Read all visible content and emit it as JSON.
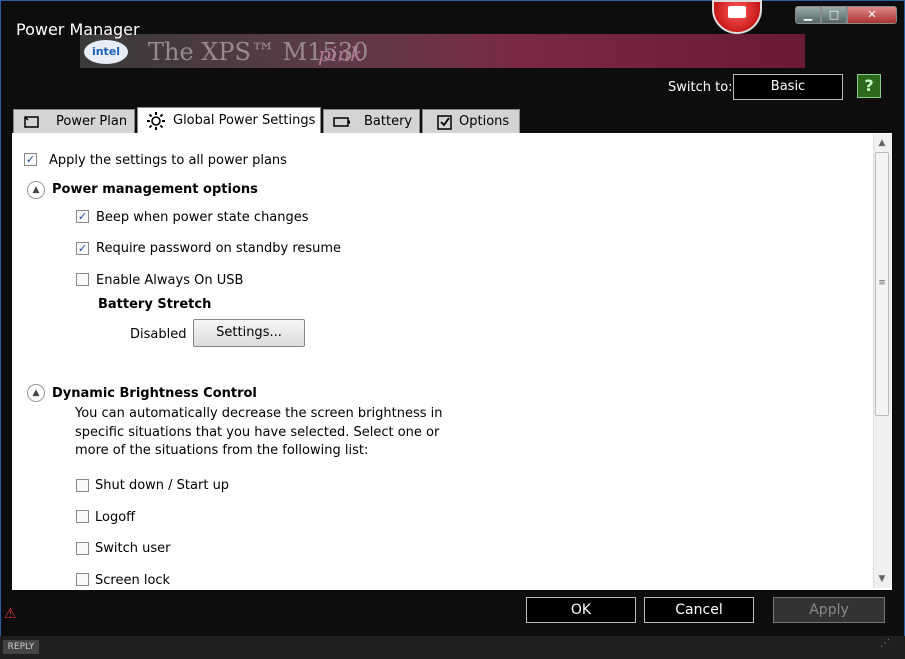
{
  "window": {
    "title": "Power Manager",
    "caption_min": "▁",
    "caption_max": "□",
    "caption_close": "✕"
  },
  "banner": {
    "logo_text": "intel",
    "text": "The XPS™ M1530",
    "text_italic": "pink"
  },
  "header": {
    "switch_label": "Switch to:",
    "switch_button": "Basic",
    "help_glyph": "?"
  },
  "tabs": [
    {
      "label": "Power Plan",
      "icon": "power-plan-icon",
      "selected": false
    },
    {
      "label": "Global Power Settings",
      "icon": "gear-icon",
      "selected": true
    },
    {
      "label": "Battery",
      "icon": "battery-icon",
      "selected": false
    },
    {
      "label": "Options",
      "icon": "checkbox-icon",
      "selected": false
    }
  ],
  "content": {
    "apply_all": {
      "label": "Apply the settings to all power plans",
      "checked": true
    },
    "power_options": {
      "heading": "Power management options",
      "items": [
        {
          "label": "Beep when power state changes",
          "checked": true
        },
        {
          "label": "Require password on standby resume",
          "checked": true
        },
        {
          "label": "Enable Always On USB",
          "checked": false
        }
      ],
      "battery_stretch": {
        "heading": "Battery Stretch",
        "status": "Disabled",
        "settings_button": "Settings..."
      }
    },
    "brightness": {
      "heading": "Dynamic Brightness Control",
      "description": [
        "You can automatically decrease the screen brightness in",
        "specific situations that you have selected. Select one or",
        "more of the situations from the following list:"
      ],
      "items": [
        {
          "label": "Shut down / Start up",
          "checked": false
        },
        {
          "label": "Logoff",
          "checked": false
        },
        {
          "label": "Switch user",
          "checked": false
        },
        {
          "label": "Screen lock",
          "checked": false
        }
      ]
    }
  },
  "footer": {
    "ok": "OK",
    "cancel": "Cancel",
    "apply": "Apply"
  },
  "taskbar": {
    "reply": "REPLY"
  },
  "glyphs": {
    "check": "✓",
    "collapse": "▲",
    "scroll_up": "▲",
    "scroll_down": "▼",
    "scroll_grip": "≡",
    "warn": "⚠",
    "resize": "⋰"
  },
  "colors": {
    "accent_check": "#2045a0",
    "close_button": "#a33333",
    "help_button": "#2e6a1e"
  }
}
